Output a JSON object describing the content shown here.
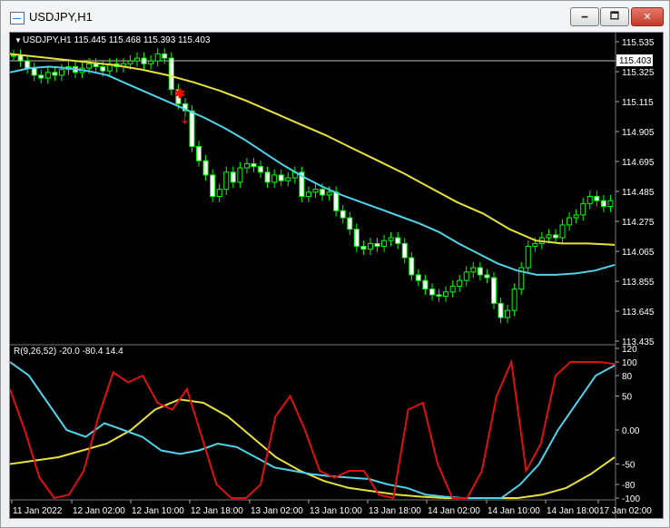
{
  "window": {
    "title": "USDJPY,H1",
    "minimize_glyph": "🗕",
    "maximize_glyph": "🗖",
    "close_glyph": "✕"
  },
  "chart": {
    "info": "USDJPY,H1  115.445 115.468 115.393 115.403",
    "current_price": "115.403",
    "price_axis_labels": [
      "115.535",
      "115.325",
      "115.115",
      "114.905",
      "114.695",
      "114.485",
      "114.275",
      "114.065",
      "113.855",
      "113.645",
      "113.435"
    ],
    "colors": {
      "bull": "#00ff00",
      "bear": "#00ff00",
      "ma_fast": "#4fd3ea",
      "ma_slow": "#e8e23a",
      "arrow": "#ff0000"
    },
    "arrow_marker": "↓",
    "star_marker": "✱"
  },
  "indicator": {
    "info": "R(9,26,52) -20.0 -80.4 14.4",
    "axis_labels": [
      "120",
      "100",
      "80",
      "50",
      "0.00",
      "-50",
      "-80",
      "-100"
    ]
  },
  "time_axis_labels": [
    "11 Jan 2022",
    "12 Jan 02:00",
    "12 Jan 10:00",
    "12 Jan 18:00",
    "13 Jan 02:00",
    "13 Jan 10:00",
    "13 Jan 18:00",
    "14 Jan 02:00",
    "14 Jan 10:00",
    "14 Jan 18:00",
    "17 Jan 02:00"
  ],
  "chart_data": {
    "type": "candlestick",
    "price_range": [
      113.435,
      115.535
    ],
    "ma_fast": [
      115.32,
      115.35,
      115.36,
      115.35,
      115.33,
      115.3,
      115.24,
      115.18,
      115.12,
      115.06,
      115.0,
      114.93,
      114.85,
      114.76,
      114.67,
      114.59,
      114.52,
      114.46,
      114.41,
      114.36,
      114.31,
      114.26,
      114.2,
      114.12,
      114.05,
      113.98,
      113.93,
      113.9,
      113.9,
      113.91,
      113.93,
      113.97
    ],
    "ma_slow": [
      115.45,
      115.43,
      115.41,
      115.39,
      115.37,
      115.34,
      115.3,
      115.25,
      115.19,
      115.12,
      115.04,
      114.96,
      114.88,
      114.79,
      114.7,
      114.61,
      114.51,
      114.41,
      114.33,
      114.22,
      114.14,
      114.12,
      114.12,
      114.11
    ],
    "indicator_range": [
      -100,
      120
    ],
    "indicator_red": [
      60,
      0,
      -70,
      -100,
      -95,
      -60,
      20,
      85,
      70,
      80,
      40,
      30,
      60,
      -10,
      -80,
      -100,
      -100,
      -80,
      20,
      50,
      0,
      -60,
      -70,
      -60,
      -60,
      -95,
      -100,
      30,
      40,
      -50,
      -100,
      -100,
      -60,
      50,
      100,
      -60,
      -20,
      80,
      100,
      100,
      100,
      97
    ],
    "indicator_cyan": [
      100,
      80,
      40,
      0,
      -10,
      10,
      0,
      -10,
      -30,
      -35,
      -30,
      -20,
      -25,
      -40,
      -55,
      -60,
      -65,
      -68,
      -70,
      -72,
      -80,
      -85,
      -95,
      -98,
      -100,
      -100,
      -100,
      -80,
      -50,
      0,
      40,
      80,
      95
    ],
    "indicator_yellow": [
      -50,
      -45,
      -40,
      -30,
      -20,
      0,
      30,
      45,
      40,
      20,
      -10,
      -40,
      -60,
      -75,
      -85,
      -90,
      -95,
      -98,
      -100,
      -100,
      -100,
      -100,
      -95,
      -85,
      -65,
      -40
    ]
  }
}
